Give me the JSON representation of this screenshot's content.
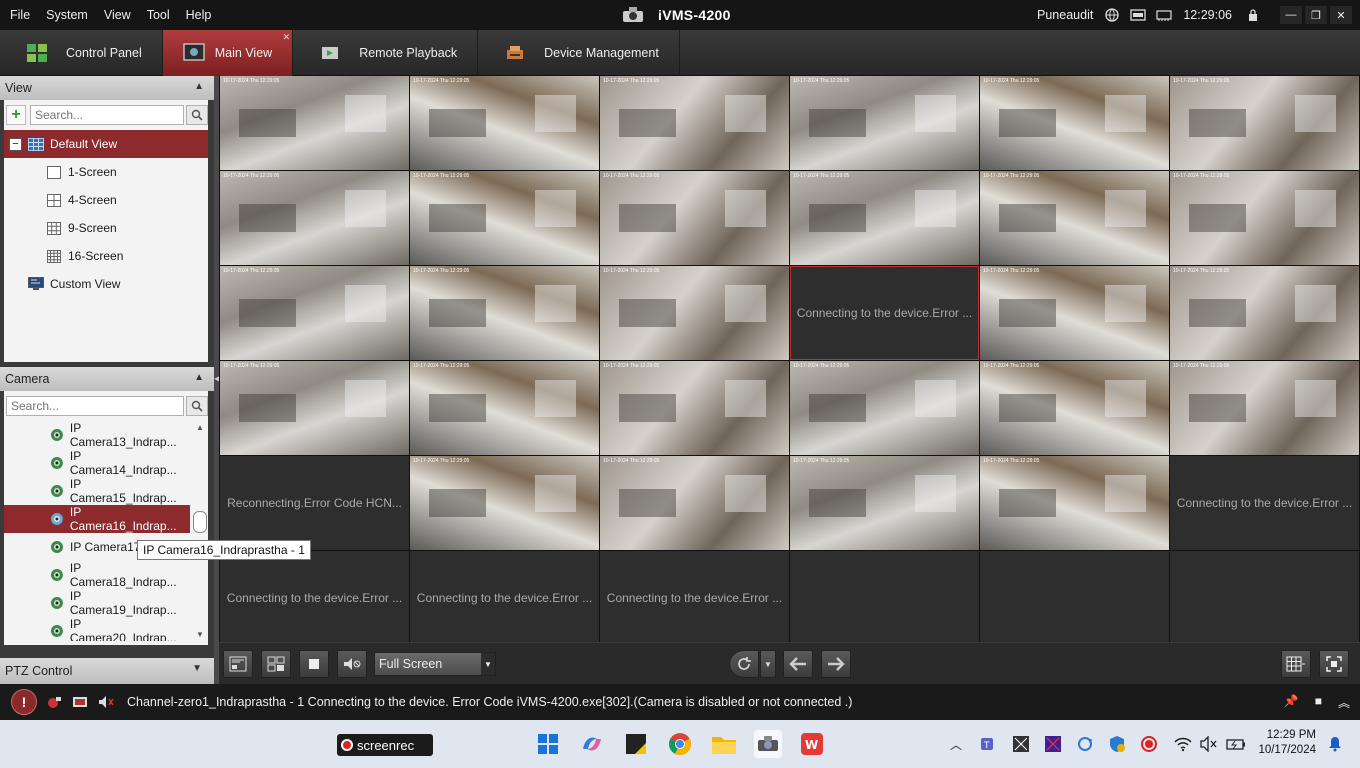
{
  "menu": [
    "File",
    "System",
    "View",
    "Tool",
    "Help"
  ],
  "app_title": "iVMS-4200",
  "user": "Puneaudit",
  "clock_time": "12:29:06",
  "tabs": [
    {
      "label": "Control Panel",
      "active": false
    },
    {
      "label": "Main View",
      "active": true
    },
    {
      "label": "Remote Playback",
      "active": false
    },
    {
      "label": "Device Management",
      "active": false
    }
  ],
  "view_panel": {
    "title": "View",
    "search_placeholder": "Search...",
    "default_view": "Default View",
    "screens": [
      "1-Screen",
      "4-Screen",
      "9-Screen",
      "16-Screen"
    ],
    "custom_view": "Custom View"
  },
  "camera_panel": {
    "title": "Camera",
    "search_placeholder": "Search...",
    "cameras": [
      "IP Camera13_Indrap...",
      "IP Camera14_Indrap...",
      "IP Camera15_Indrap...",
      "IP Camera16_Indrap...",
      "IP Camera17",
      "IP Camera18_Indrap...",
      "IP Camera19_Indrap...",
      "IP Camera20_Indrap..."
    ],
    "selected_index": 3,
    "tooltip": "IP Camera16_Indraprastha - 1"
  },
  "ptz_title": "PTZ Control",
  "grid": {
    "cells": [
      "feed",
      "feed",
      "feed",
      "feed",
      "feed",
      "feed",
      "feed",
      "feed",
      "feed",
      "feed",
      "feed",
      "feed",
      "feed",
      "feed",
      "feed",
      "err1",
      "feed",
      "feed",
      "feed",
      "feed",
      "feed",
      "feed",
      "feed",
      "feed",
      "err2",
      "feed",
      "feed",
      "feed",
      "feed",
      "err1",
      "err1",
      "err1",
      "err1",
      "empty",
      "empty",
      "empty"
    ],
    "msg_connecting": "Connecting to the device.Error ...",
    "msg_reconnecting": "Reconnecting.Error Code HCN...",
    "timestamp": "10-17-2024 Thu 12:29:05"
  },
  "toolbar": {
    "screen_mode": "Full Screen"
  },
  "status_message": "Channel-zero1_Indraprastha - 1 Connecting to the device. Error Code iVMS-4200.exe[302].(Camera is disabled or not connected .)",
  "taskbar": {
    "screenrec_label": "screenrec",
    "time": "12:29 PM",
    "date": "10/17/2024"
  }
}
